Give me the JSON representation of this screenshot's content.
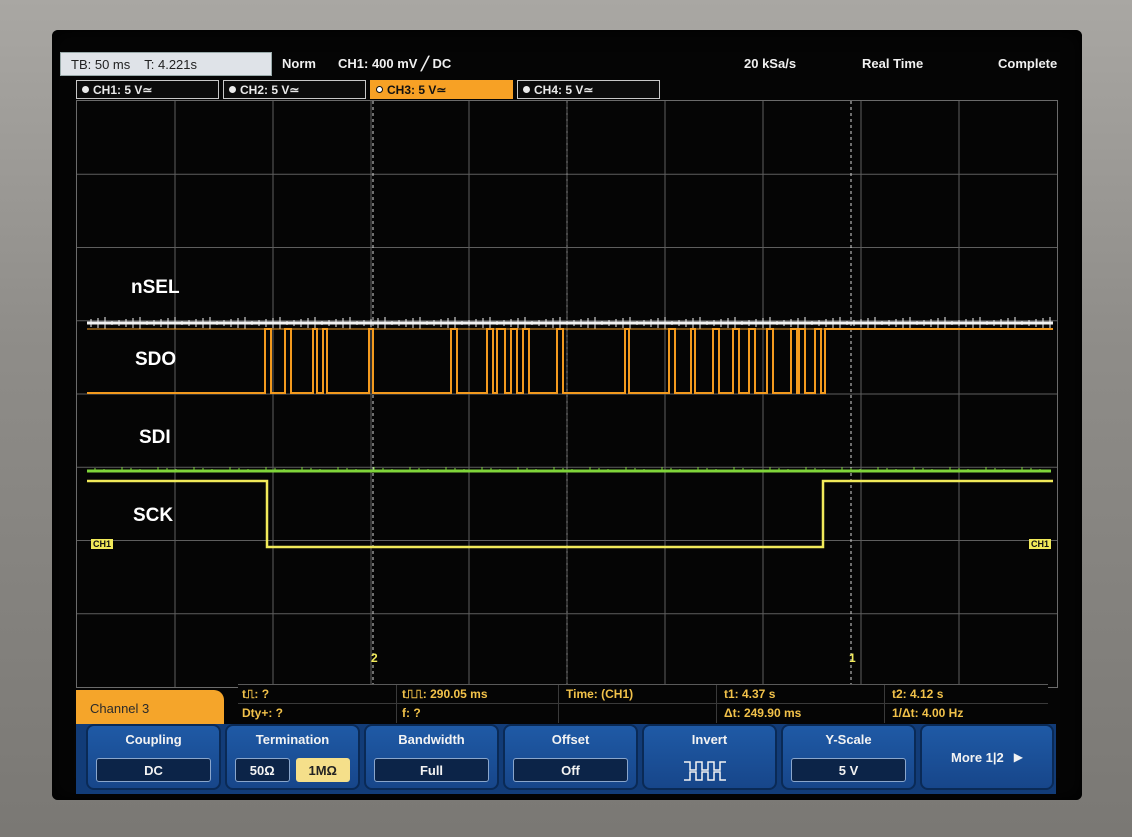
{
  "status_bar": {
    "timebase": "TB: 50 ms",
    "trigger_time": "T: 4.221s",
    "acq_mode": "Norm",
    "trigger_source": "CH1: 400 mV ╱ DC",
    "sample_rate": "20 kSa/s",
    "mode": "Real Time",
    "state": "Complete"
  },
  "channels": [
    {
      "label": "CH1: 5 V≃",
      "active": false
    },
    {
      "label": "CH2: 5 V≃",
      "active": false
    },
    {
      "label": "CH3: 5 V≃",
      "active": true
    },
    {
      "label": "CH4: 5 V≃",
      "active": false
    }
  ],
  "signal_labels": {
    "nsel": "nSEL",
    "sdo": "SDO",
    "sdi": "SDI",
    "sck": "SCK"
  },
  "markers": {
    "cursor2": "2",
    "cursor1": "1",
    "ch_left": "CH1",
    "ch_right": "CH1"
  },
  "measurements": {
    "pos_pulse": "t⎍: ?",
    "neg_pulse": "t⎍⎍: 290.05 ms",
    "time_ref": "Time:  (CH1)",
    "t1": "t1: 4.37 s",
    "t2": "t2: 4.12 s",
    "duty": "Dty+: ?",
    "freq": "f: ?",
    "dt": "Δt: 249.90 ms",
    "inv_dt": "1/Δt: 4.00 Hz"
  },
  "menu": {
    "title": "Channel 3",
    "coupling": {
      "title": "Coupling",
      "value": "DC"
    },
    "termination": {
      "title": "Termination",
      "opt1": "50Ω",
      "opt2": "1MΩ",
      "selected": "1MΩ"
    },
    "bandwidth": {
      "title": "Bandwidth",
      "value": "Full"
    },
    "offset": {
      "title": "Offset",
      "value": "Off"
    },
    "invert": {
      "title": "Invert"
    },
    "yscale": {
      "title": "Y-Scale",
      "value": "5 V"
    },
    "more": "More 1|2"
  },
  "colors": {
    "nsel": "#f2f2f2",
    "sdo": "#f39a1e",
    "sdi": "#7fd43a",
    "sck": "#f1ea5a",
    "accent": "#f5a52a"
  }
}
